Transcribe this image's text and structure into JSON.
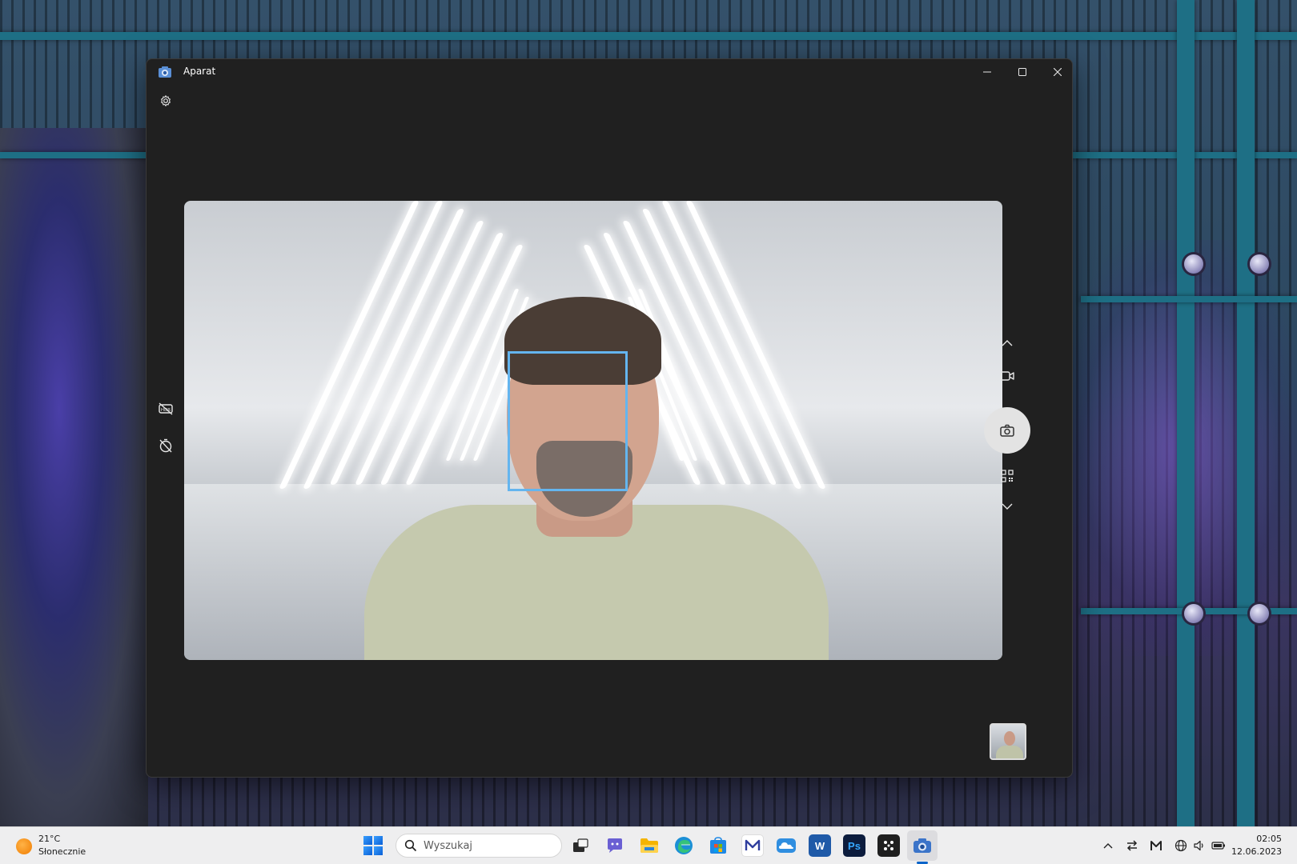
{
  "window": {
    "title": "Aparat",
    "controls": [
      "minimize",
      "maximize",
      "close"
    ]
  },
  "camera": {
    "left_toolbar": [
      "hdr-off-icon",
      "timer-off-icon"
    ],
    "right_rail": [
      "chevron-up-icon",
      "video-mode-icon",
      "photo-shutter-icon",
      "qr-scan-icon",
      "chevron-down-icon"
    ],
    "face_detected": true
  },
  "taskbar": {
    "weather": {
      "temp": "21°C",
      "desc": "Słonecznie"
    },
    "search": {
      "placeholder": "Wyszukaj"
    },
    "pinned_apps": [
      "task-view",
      "teams-chat",
      "file-explorer",
      "edge",
      "microsoft-store",
      "mailbird",
      "onedrive",
      "word",
      "photoshop",
      "app-grid",
      "camera"
    ],
    "active_app": "camera",
    "tray": [
      "show-hidden-icon",
      "network-transfer-icon",
      "mailbird-tray-icon",
      "language-globe-icon",
      "volume-icon",
      "battery-icon"
    ],
    "clock": {
      "time": "02:05",
      "date": "12.06.2023"
    }
  },
  "colors": {
    "window_bg": "#202020",
    "face_box": "#64b5ef",
    "taskbar_bg": "#eeeeef",
    "accent": "#0a64c9"
  }
}
